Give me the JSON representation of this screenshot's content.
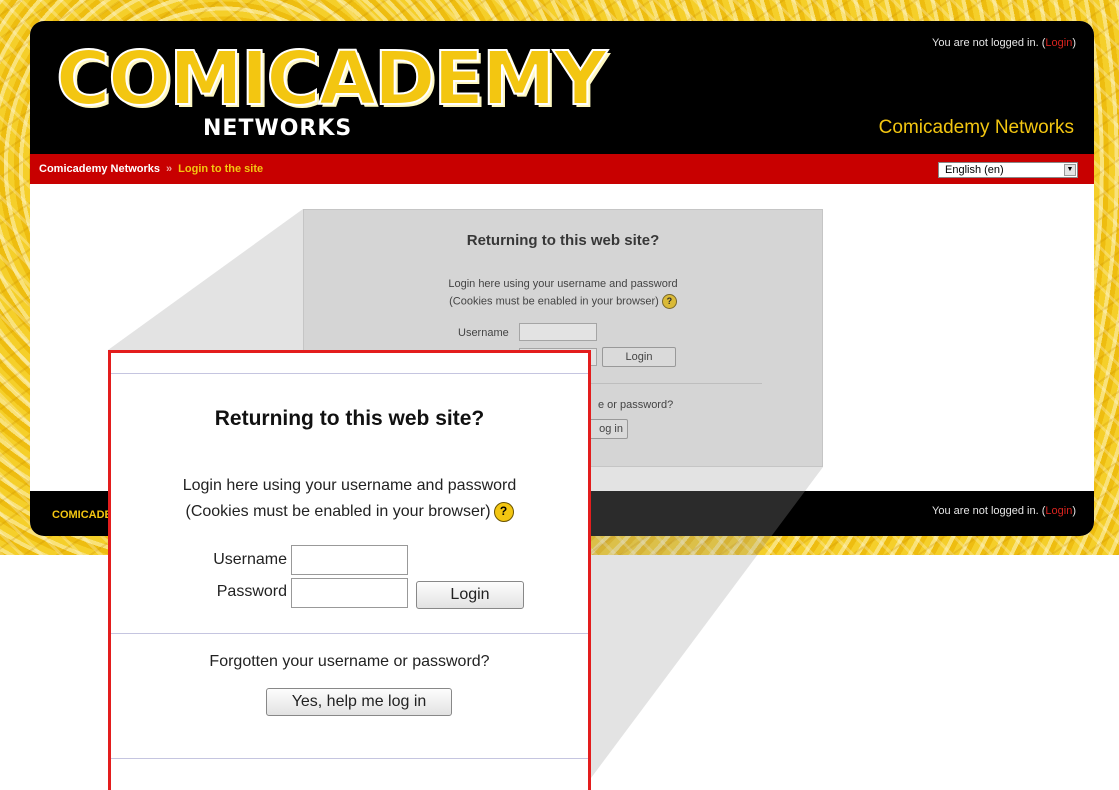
{
  "header": {
    "logo_title": "COMICADEMY",
    "logo_subtitle": "NETWORKS",
    "login_status": "You are not logged in. (",
    "login_link": "Login",
    "login_close": ")",
    "site_name": "Comicademy Networks"
  },
  "breadcrumb": {
    "home": "Comicademy Networks",
    "separator": "»",
    "current": "Login to the site"
  },
  "language": {
    "selected": "English (en)"
  },
  "footer": {
    "logo": "COMICADEMY",
    "login_status": "You are not logged in. (",
    "login_link": "Login",
    "login_close": ")"
  },
  "login_panel": {
    "title": "Returning to this web site?",
    "intro": "Login here using your username and password",
    "cookies_note": "(Cookies must be enabled in your browser)",
    "help_symbol": "?",
    "username_label": "Username",
    "password_label": "Password",
    "login_button": "Login",
    "forgot_text": "Forgotten your username or password?",
    "forgot_partial": "e or password?",
    "help_button": "Yes, help me log in",
    "help_button_partial": "og in"
  },
  "colors": {
    "accent_yellow": "#f3c611",
    "nav_red": "#c80000",
    "callout_border": "#e31d1d"
  }
}
